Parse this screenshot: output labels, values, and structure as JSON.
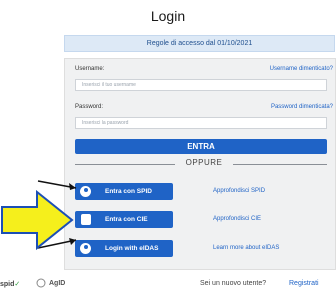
{
  "title": "Login",
  "rules_banner": "Regole di accesso dal 01/10/2021",
  "username": {
    "label": "Username:",
    "placeholder": "Inserisci il tuo username",
    "forgot_link": "Username dimenticato?"
  },
  "password": {
    "label": "Password:",
    "placeholder": "Inserisci la password",
    "forgot_link": "Password dimenticata?"
  },
  "submit_label": "ENTRA",
  "separator": "OPPURE",
  "identity_providers": [
    {
      "label": "Entra con SPID",
      "info_link": "Approfondisci SPID"
    },
    {
      "label": "Entra con CIE",
      "info_link": "Approfondisci CIE"
    },
    {
      "label": "Login with eIDAS",
      "info_link": "Learn more about eIDAS"
    }
  ],
  "footer": {
    "spid_logo": "spid",
    "agid_logo": "AgID",
    "new_user_text": "Sei un nuovo utente?",
    "register_link": "Registrati"
  },
  "colors": {
    "primary": "#1f63c6",
    "arrow_yellow": "#f5ef1c",
    "arrow_outline": "#1c4fb5"
  }
}
